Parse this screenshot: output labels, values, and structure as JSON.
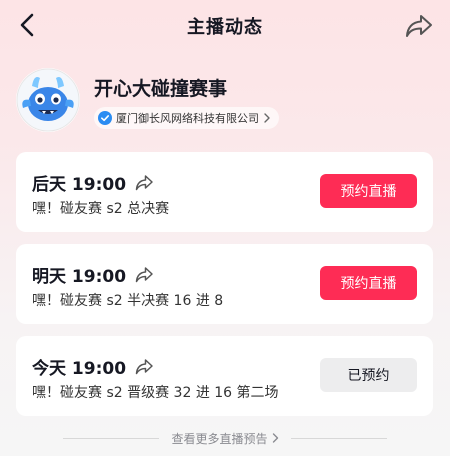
{
  "header": {
    "title": "主播动态",
    "back_icon": "chevron-left-icon",
    "share_icon": "share-arrow-icon"
  },
  "profile": {
    "name": "开心大碰撞赛事",
    "org": "厦门御长风网络科技有限公司",
    "verify_icon": "verified-check-icon",
    "accent": "#2b8cf2"
  },
  "streams": [
    {
      "time": "后天 19:00",
      "desc": "嘿！碰友赛 s2 总决赛",
      "button": "预约直播",
      "reserved": false
    },
    {
      "time": "明天 19:00",
      "desc": "嘿！碰友赛 s2 半决赛 16 进 8",
      "button": "预约直播",
      "reserved": false
    },
    {
      "time": "今天 19:00",
      "desc": "嘿！碰友赛 s2 晋级赛 32 进 16 第二场",
      "button": "已预约",
      "reserved": true
    }
  ],
  "footer": {
    "more_label": "查看更多直播预告"
  },
  "colors": {
    "primary": "#fe2c55",
    "reserved_bg": "#ededee"
  }
}
